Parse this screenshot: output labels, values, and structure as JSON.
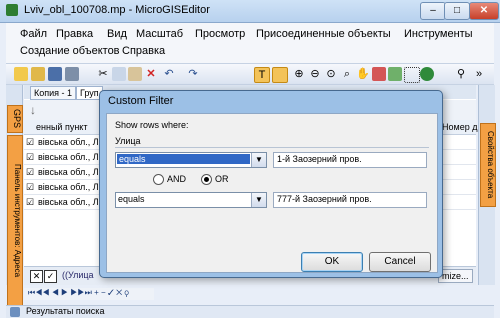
{
  "window": {
    "title": "Lviv_obl_100708.mp - MicroGISEditor",
    "min": "–",
    "max": "□",
    "close": "✕"
  },
  "menu": {
    "row1": [
      "Файл",
      "Правка",
      "Вид",
      "Масштаб",
      "Просмотр",
      "Присоединенные объекты",
      "Инструменты"
    ],
    "row2": [
      "Создание объектов",
      "Справка"
    ]
  },
  "side_tabs": {
    "gps": "GPS",
    "tools": "Панель инструментов: Адреса",
    "right": "Свойства объекта"
  },
  "tabs": [
    "Копия - 1",
    "Груп"
  ],
  "table": {
    "headers": [
      "енный пункт",
      "Номер д"
    ],
    "rows": [
      {
        "checked": true,
        "text": "вівська обл., Ль"
      },
      {
        "checked": true,
        "text": "вівська обл., Ль"
      },
      {
        "checked": true,
        "text": "вівська обл., Ль"
      },
      {
        "checked": true,
        "text": "вівська обл., Ль"
      },
      {
        "checked": true,
        "text": "вівська обл., Ль"
      }
    ]
  },
  "filter_bar": {
    "text": "((Улица",
    "customize": "mize..."
  },
  "status_bar": {
    "label": "Результаты поиска"
  },
  "dialog": {
    "title": "Custom Filter",
    "show_rows_label": "Show rows where:",
    "field_label": "Улица",
    "row1": {
      "operator": "equals",
      "value": "1-й Заозерний пров."
    },
    "row2": {
      "operator": "equals",
      "value": "777-й Заозерний пров."
    },
    "logic": {
      "and_label": "AND",
      "or_label": "OR",
      "selected": "OR"
    },
    "ok_label": "OK",
    "cancel_label": "Cancel"
  },
  "colors": {
    "accent": "#3068c6",
    "title_bar": "#b7d1ee",
    "side_tab": "#f3a044"
  }
}
